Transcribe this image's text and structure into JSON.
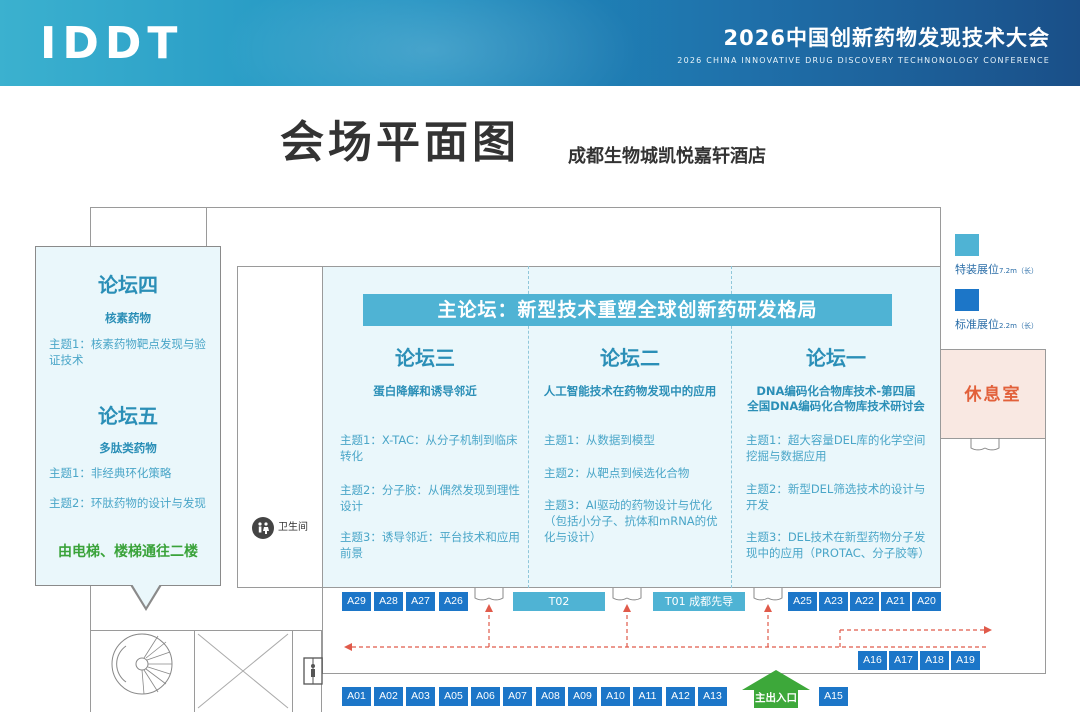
{
  "banner": {
    "logo": "IDDT",
    "title": "2026中国创新药物发现技术大会",
    "subtitle": "2026 CHINA INNOVATIVE DRUG DISCOVERY TECHNONOLOGY CONFERENCE"
  },
  "page": {
    "title": "会场平面图",
    "venue": "成都生物城凯悦嘉轩酒店"
  },
  "main_forum": "主论坛：新型技术重塑全球创新药研发格局",
  "forums": {
    "f3": {
      "name": "论坛三",
      "sub": "蛋白降解和诱导邻近",
      "topics": [
        "主题1：X-TAC：从分子机制到临床转化",
        "主题2：分子胶：从偶然发现到理性设计",
        "主题3：诱导邻近：平台技术和应用前景"
      ]
    },
    "f2": {
      "name": "论坛二",
      "sub": "人工智能技术在药物发现中的应用",
      "topics": [
        "主题1：从数据到模型",
        "主题2：从靶点到候选化合物",
        "主题3：AI驱动的药物设计与优化（包括小分子、抗体和mRNA的优化与设计）"
      ]
    },
    "f1": {
      "name": "论坛一",
      "sub1": "DNA编码化合物库技术-第四届",
      "sub2": "全国DNA编码化合物库技术研讨会",
      "topics": [
        "主题1：超大容量DEL库的化学空间挖掘与数据应用",
        "主题2：新型DEL筛选技术的设计与开发",
        "主题3：DEL技术在新型药物分子发现中的应用（PROTAC、分子胶等）"
      ]
    },
    "f4": {
      "name": "论坛四",
      "sub": "核素药物",
      "topics": [
        "主题1：核素药物靶点发现与验证技术"
      ]
    },
    "f5": {
      "name": "论坛五",
      "sub": "多肽类药物",
      "topics": [
        "主题1：非经典环化策略",
        "主题2：环肽药物的设计与发现"
      ]
    }
  },
  "elevator_note": "由电梯、楼梯通往二楼",
  "restroom_label": "卫生间",
  "lounge_label": "休息室",
  "legend": {
    "special": {
      "label": "特装展位",
      "size": "7.2m（长）",
      "color": "#4fb3d4"
    },
    "standard": {
      "label": "标准展位",
      "size": "2.2m（长）",
      "color": "#1c76c8"
    }
  },
  "booths_top_left": [
    "A29",
    "A28",
    "A27",
    "A26"
  ],
  "booths_top_right": [
    "A25",
    "A23",
    "A22",
    "A21",
    "A20"
  ],
  "special_booths": {
    "t02": "T02",
    "t01": "T01 成都先导"
  },
  "booths_right_mid": [
    "A16",
    "A17",
    "A18",
    "A19"
  ],
  "booths_bottom": [
    "A01",
    "A02",
    "A03",
    "A05",
    "A06",
    "A07",
    "A08",
    "A09",
    "A10",
    "A11",
    "A12",
    "A13"
  ],
  "booth_a15": "A15",
  "entrance_label": "主出入口"
}
